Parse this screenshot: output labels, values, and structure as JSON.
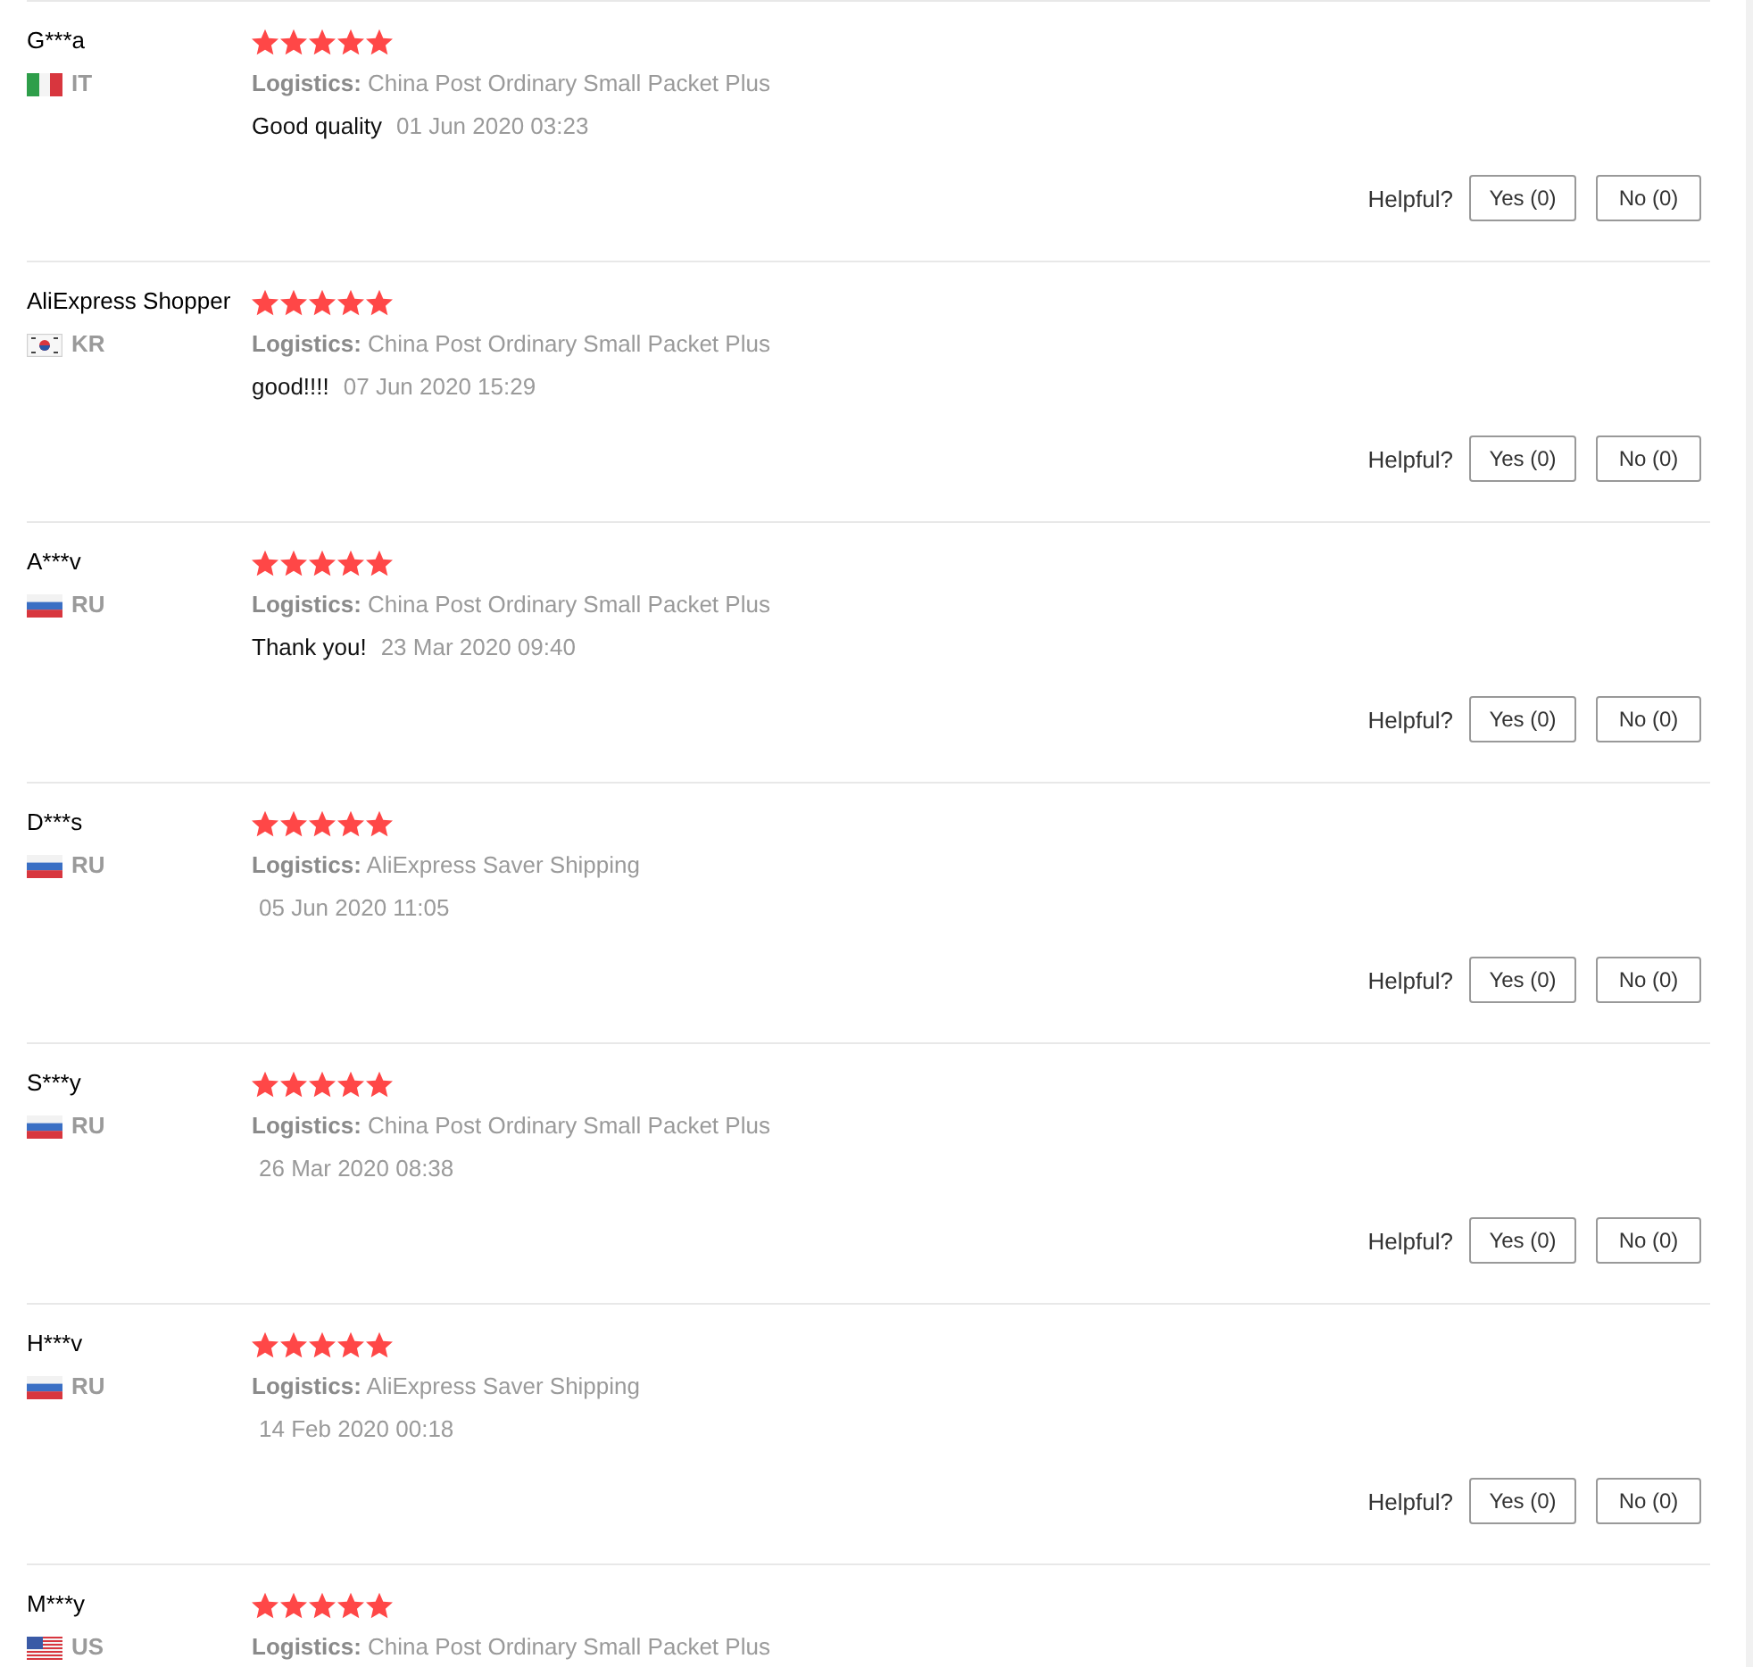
{
  "reviews": [
    {
      "name": "G***a",
      "country": {
        "code": "IT",
        "kind": "italy"
      },
      "stars": 5,
      "logistics": "**Logistics:** China Post Ordinary Small Packet Plus",
      "comment": "Good quality",
      "date": "01 Jun 2020 03:23",
      "helpful": {
        "label": "Helpful?",
        "yes": "Yes (0)",
        "no": "No (0)"
      }
    },
    {
      "name": "AliExpress Shopper",
      "country": {
        "code": "KR",
        "kind": "korea"
      },
      "stars": 5,
      "logistics": "**Logistics:** China Post Ordinary Small Packet Plus",
      "comment": "good!!!!",
      "date": "07 Jun 2020 15:29",
      "helpful": {
        "label": "Helpful?",
        "yes": "Yes (0)",
        "no": "No (0)"
      }
    },
    {
      "name": "A***v",
      "country": {
        "code": "RU",
        "kind": "russia"
      },
      "stars": 5,
      "logistics": "**Logistics:** China Post Ordinary Small Packet Plus",
      "comment": "Thank you!",
      "date": "23 Mar 2020 09:40",
      "helpful": {
        "label": "Helpful?",
        "yes": "Yes (0)",
        "no": "No (0)"
      }
    },
    {
      "name": "D***s",
      "country": {
        "code": "RU",
        "kind": "russia"
      },
      "stars": 5,
      "logistics": "**Logistics:** AliExpress Saver Shipping",
      "date": "05 Jun 2020 11:05",
      "helpful": {
        "label": "Helpful?",
        "yes": "Yes (0)",
        "no": "No (0)"
      }
    },
    {
      "name": "S***y",
      "country": {
        "code": "RU",
        "kind": "russia"
      },
      "stars": 5,
      "logistics": "**Logistics:** China Post Ordinary Small Packet Plus",
      "date": "26 Mar 2020 08:38",
      "helpful": {
        "label": "Helpful?",
        "yes": "Yes (0)",
        "no": "No (0)"
      }
    },
    {
      "name": "H***v",
      "country": {
        "code": "RU",
        "kind": "russia"
      },
      "stars": 5,
      "logistics": "**Logistics:** AliExpress Saver Shipping",
      "date": "14 Feb 2020 00:18",
      "helpful": {
        "label": "Helpful?",
        "yes": "Yes (0)",
        "no": "No (0)"
      }
    },
    {
      "name": "M***y",
      "country": {
        "code": "US",
        "kind": "usa"
      },
      "stars": 5,
      "logistics": "**Logistics:** China Post Ordinary Small Packet Plus"
    }
  ]
}
